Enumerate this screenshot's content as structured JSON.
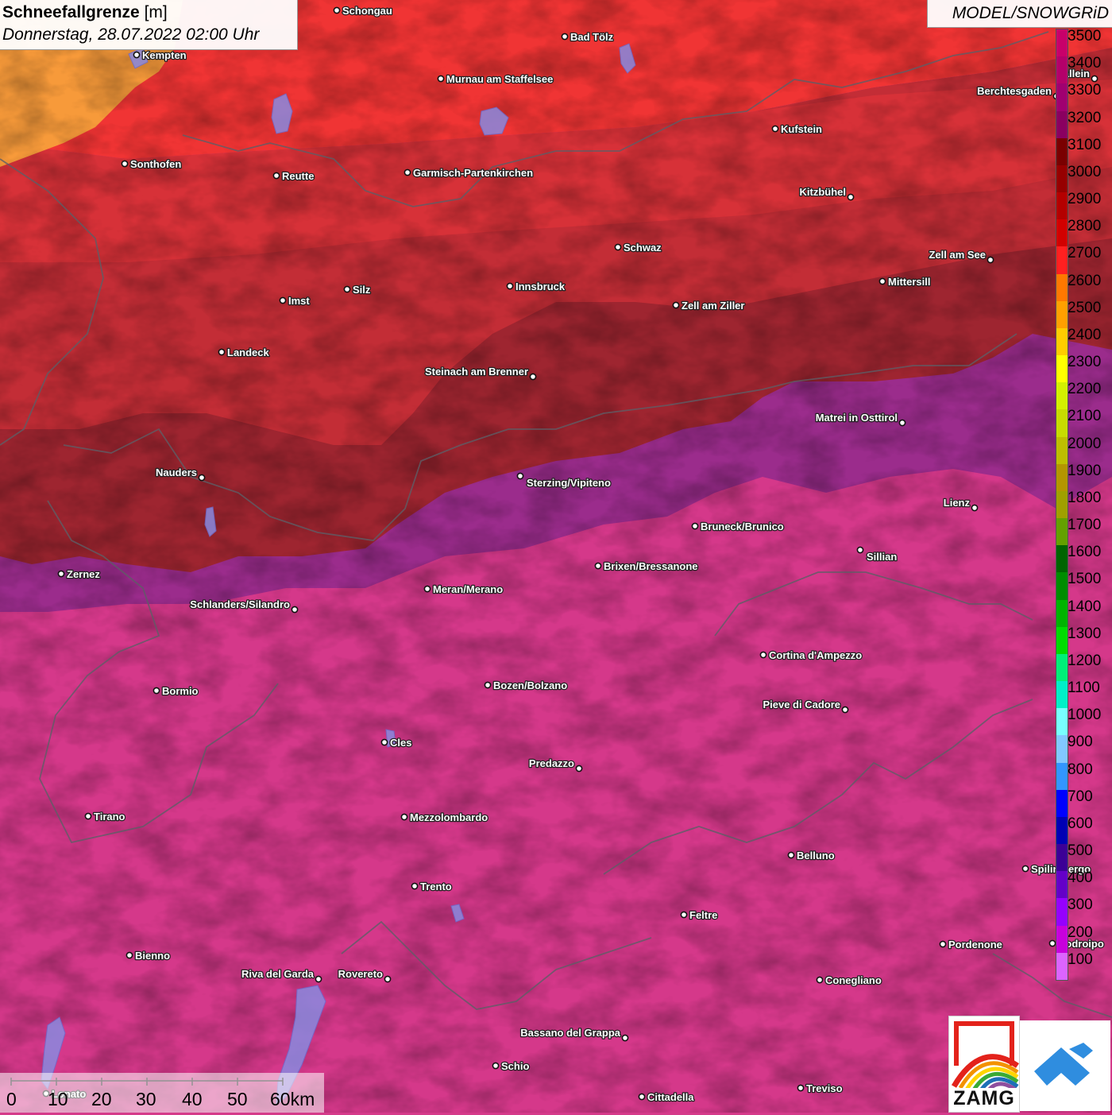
{
  "header": {
    "title_bold": "Schneefallgrenze",
    "title_unit": "[m]",
    "datetime": "Donnerstag, 28.07.2022 02:00 Uhr",
    "model": "MODEL/SNOWGRiD"
  },
  "legend": {
    "steps": [
      {
        "label": "3500",
        "color": "#c8006a"
      },
      {
        "label": "3400",
        "color": "#b4006a"
      },
      {
        "label": "3300",
        "color": "#a00070"
      },
      {
        "label": "3200",
        "color": "#8a0060"
      },
      {
        "label": "3100",
        "color": "#7a0000"
      },
      {
        "label": "3000",
        "color": "#960000"
      },
      {
        "label": "2900",
        "color": "#b40000"
      },
      {
        "label": "2800",
        "color": "#d20000"
      },
      {
        "label": "2700",
        "color": "#ff2020"
      },
      {
        "label": "2600",
        "color": "#ff7800"
      },
      {
        "label": "2500",
        "color": "#ffa000"
      },
      {
        "label": "2400",
        "color": "#ffcc00"
      },
      {
        "label": "2300",
        "color": "#ffff00"
      },
      {
        "label": "2200",
        "color": "#d4f000"
      },
      {
        "label": "2100",
        "color": "#c8dc00"
      },
      {
        "label": "2000",
        "color": "#bebe00"
      },
      {
        "label": "1900",
        "color": "#b49600"
      },
      {
        "label": "1800",
        "color": "#a0a000"
      },
      {
        "label": "1700",
        "color": "#64a000"
      },
      {
        "label": "1600",
        "color": "#006400"
      },
      {
        "label": "1500",
        "color": "#008c00"
      },
      {
        "label": "1400",
        "color": "#00b400"
      },
      {
        "label": "1300",
        "color": "#00dc00"
      },
      {
        "label": "1200",
        "color": "#00f078"
      },
      {
        "label": "1100",
        "color": "#00f0c8"
      },
      {
        "label": "1000",
        "color": "#78ffff"
      },
      {
        "label": "900",
        "color": "#82c8ff"
      },
      {
        "label": "800",
        "color": "#3296ff"
      },
      {
        "label": "700",
        "color": "#0000ff"
      },
      {
        "label": "600",
        "color": "#0000b4"
      },
      {
        "label": "500",
        "color": "#3c0096"
      },
      {
        "label": "400",
        "color": "#6400c8"
      },
      {
        "label": "300",
        "color": "#9600ff"
      },
      {
        "label": "200",
        "color": "#c800dc"
      },
      {
        "label": "100",
        "color": "#dc64ff"
      }
    ]
  },
  "cities": [
    {
      "name": "Schongau"
    },
    {
      "name": "Bad Tölz"
    },
    {
      "name": "Kempten"
    },
    {
      "name": "Murnau am Staffelsee"
    },
    {
      "name": "Hallein"
    },
    {
      "name": "Berchtesgaden"
    },
    {
      "name": "Kufstein"
    },
    {
      "name": "Sonthofen"
    },
    {
      "name": "Reutte"
    },
    {
      "name": "Garmisch-Partenkirchen"
    },
    {
      "name": "Kitzbühel"
    },
    {
      "name": "Schwaz"
    },
    {
      "name": "Zell am See"
    },
    {
      "name": "Mittersill"
    },
    {
      "name": "Innsbruck"
    },
    {
      "name": "Silz"
    },
    {
      "name": "Imst"
    },
    {
      "name": "Zell am Ziller"
    },
    {
      "name": "Landeck"
    },
    {
      "name": "Steinach am Brenner"
    },
    {
      "name": "Matrei in Osttirol"
    },
    {
      "name": "Nauders"
    },
    {
      "name": "Sterzing/Vipiteno"
    },
    {
      "name": "Lienz"
    },
    {
      "name": "Bruneck/Brunico"
    },
    {
      "name": "Sillian"
    },
    {
      "name": "Zernez"
    },
    {
      "name": "Brixen/Bressanone"
    },
    {
      "name": "Meran/Merano"
    },
    {
      "name": "Schlanders/Silandro"
    },
    {
      "name": "Cortina d'Ampezzo"
    },
    {
      "name": "Bozen/Bolzano"
    },
    {
      "name": "Bormio"
    },
    {
      "name": "Pieve di Cadore"
    },
    {
      "name": "Cles"
    },
    {
      "name": "Predazzo"
    },
    {
      "name": "Tirano"
    },
    {
      "name": "Mezzolombardo"
    },
    {
      "name": "Belluno"
    },
    {
      "name": "Spilimbergo"
    },
    {
      "name": "Trento"
    },
    {
      "name": "Feltre"
    },
    {
      "name": "Pordenone"
    },
    {
      "name": "Codroipo"
    },
    {
      "name": "Bienno"
    },
    {
      "name": "Riva del Garda"
    },
    {
      "name": "Rovereto"
    },
    {
      "name": "Conegliano"
    },
    {
      "name": "Bassano del Grappa"
    },
    {
      "name": "Schio"
    },
    {
      "name": "Lonato"
    },
    {
      "name": "Treviso"
    },
    {
      "name": "Cittadella"
    }
  ],
  "scale": {
    "ticks": [
      "0",
      "10",
      "20",
      "30",
      "40",
      "50",
      "60km"
    ]
  },
  "logos": {
    "zamg": "ZAMG",
    "colors": {
      "red": "#e3221b",
      "orange": "#f39200",
      "yellow": "#ffd500",
      "green": "#3aaa35",
      "blue": "#1d70b7",
      "violet": "#8e4f9e",
      "snow_blue": "#2f8ddf"
    }
  },
  "map_colors": {
    "orange_zone": "#f79a3a",
    "red_zone": "#f03434",
    "dark_red_zone": "#c22e38",
    "maroon_zone": "#9e2430",
    "purple_zone": "#9a2a8a",
    "magenta_zone": "#d5388a"
  }
}
